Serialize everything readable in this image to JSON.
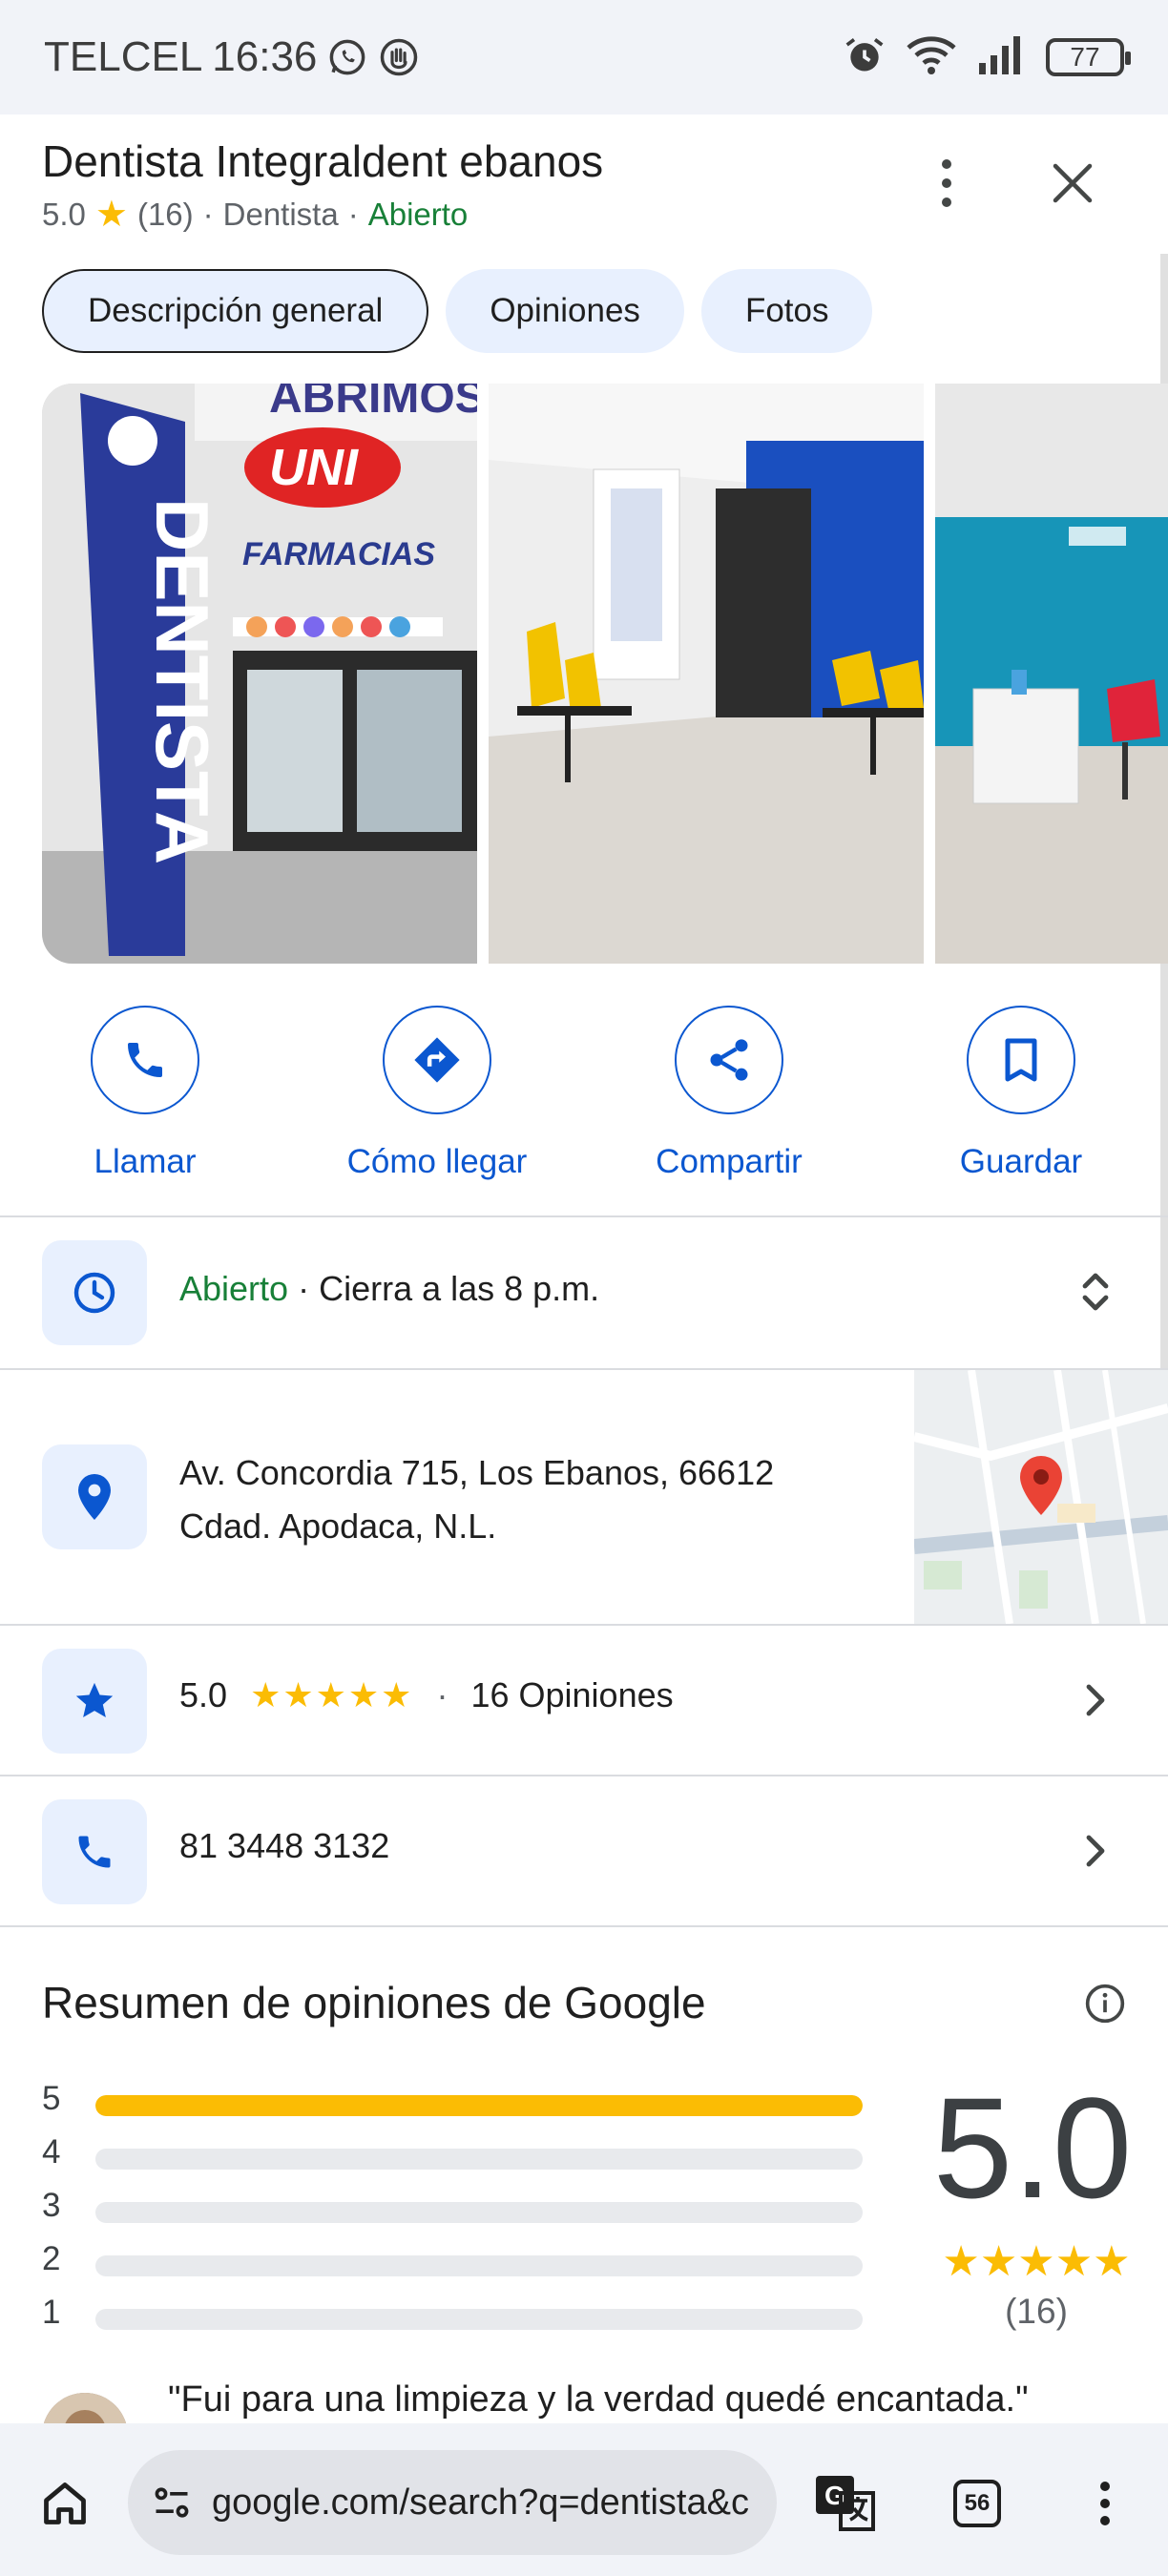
{
  "status_bar": {
    "carrier": "TELCEL",
    "time": "16:36",
    "battery": "77"
  },
  "place": {
    "name": "Dentista Integraldent ebanos",
    "rating": "5.0",
    "review_count": "(16)",
    "category": "Dentista",
    "status": "Abierto",
    "separator": "·"
  },
  "tabs": [
    {
      "label": "Descripción general",
      "active": true
    },
    {
      "label": "Opiniones",
      "active": false
    },
    {
      "label": "Fotos",
      "active": false
    }
  ],
  "photos": [
    {
      "banner_text": "DENTISTA",
      "sign_text": "UNI",
      "sign_sub": "FARMACIAS",
      "wall_text": "ABRIMOS!"
    },
    {
      "alt": "waiting-room-hallway"
    },
    {
      "alt": "dental-office"
    }
  ],
  "actions": [
    {
      "label": "Llamar",
      "icon": "phone-icon"
    },
    {
      "label": "Cómo llegar",
      "icon": "directions-icon"
    },
    {
      "label": "Compartir",
      "icon": "share-icon"
    },
    {
      "label": "Guardar",
      "icon": "bookmark-icon"
    }
  ],
  "hours": {
    "status": "Abierto",
    "detail": " · Cierra a las 8 p.m."
  },
  "address": {
    "line1": "Av. Concordia 715, Los Ebanos, 66612",
    "line2": "Cdad. Apodaca, N.L."
  },
  "rating_row": {
    "rating": "5.0",
    "stars": "★★★★★",
    "separator": "·",
    "reviews": "16 Opiniones"
  },
  "phone": {
    "number": "81 3448 3132"
  },
  "summary": {
    "title": "Resumen de opiniones de Google",
    "rating": "5.0",
    "stars": "★★★★★",
    "count": "(16)",
    "distribution": [
      {
        "star": "5",
        "fraction": 1.0
      },
      {
        "star": "4",
        "fraction": 0.0
      },
      {
        "star": "3",
        "fraction": 0.0
      },
      {
        "star": "2",
        "fraction": 0.0
      },
      {
        "star": "1",
        "fraction": 0.0
      }
    ]
  },
  "review_snippet": "\"Fui para una limpieza y la verdad quedé encantada.\"",
  "browser": {
    "url": "google.com/search?q=dentista&c",
    "tab_count": "56"
  },
  "colors": {
    "accent": "#0b57d0",
    "open_green": "#188038",
    "star_yellow": "#fbbc04",
    "chip_bg": "#e8f0fe"
  }
}
